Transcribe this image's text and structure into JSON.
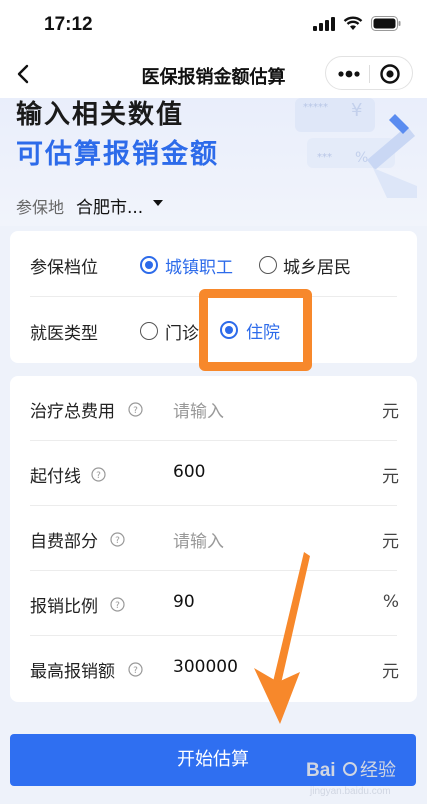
{
  "status_bar": {
    "time": "17:12"
  },
  "nav": {
    "title": "医保报销金额估算"
  },
  "hero": {
    "line1": "输入相关数值",
    "line2": "可估算报销金额",
    "location_label": "参保地",
    "location_value": "合肥市..."
  },
  "insurance": {
    "label": "参保档位",
    "options": [
      "城镇职工",
      "城乡居民"
    ],
    "selected": "城镇职工"
  },
  "visit_type": {
    "label": "就医类型",
    "options": [
      "门诊",
      "住院"
    ],
    "selected": "住院"
  },
  "fields": [
    {
      "label": "治疗总费用",
      "value": "",
      "placeholder": "请输入",
      "unit": "元"
    },
    {
      "label": "起付线",
      "value": "600",
      "placeholder": "",
      "unit": "元"
    },
    {
      "label": "自费部分",
      "value": "",
      "placeholder": "请输入",
      "unit": "元"
    },
    {
      "label": "报销比例",
      "value": "90",
      "placeholder": "",
      "unit": "%"
    },
    {
      "label": "最高报销额",
      "value": "300000",
      "placeholder": "",
      "unit": "元"
    }
  ],
  "start_button": {
    "label": "开始估算"
  },
  "watermark": {
    "brand": "Bai",
    "brand_suffix": "经验",
    "url": "jingyan.baidu.com"
  },
  "colors": {
    "accent": "#2d6bea",
    "annotation": "#f7882b",
    "button": "#2f6ff1"
  },
  "icons": [
    "back-icon",
    "more-icon",
    "close-icon",
    "dropdown-icon",
    "help-icon",
    "signal-icon",
    "wifi-icon",
    "battery-icon"
  ]
}
